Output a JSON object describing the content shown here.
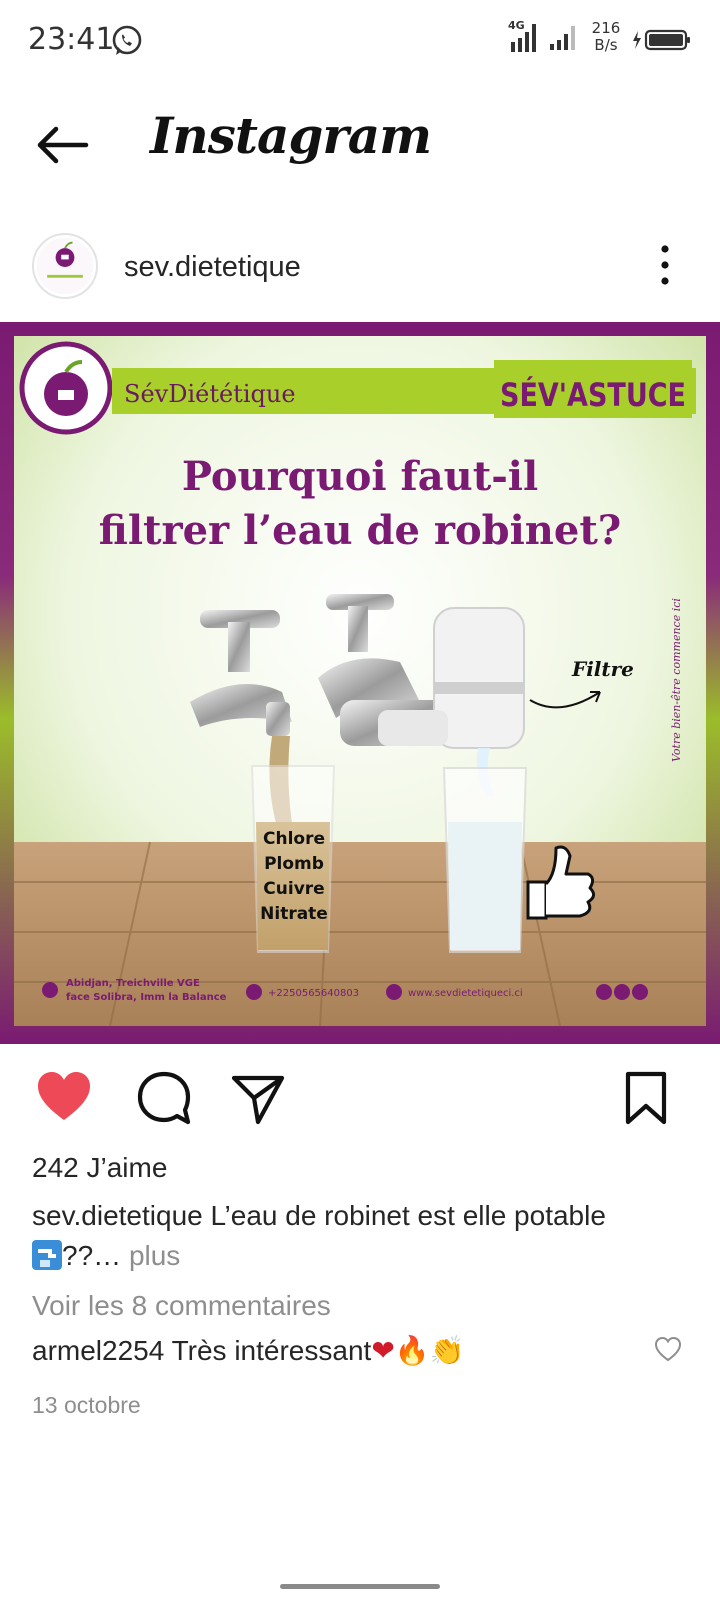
{
  "status_bar": {
    "time": "23:41",
    "network_type": "4G",
    "speed_value": "216",
    "speed_unit": "B/s"
  },
  "header": {
    "title": "Instagram"
  },
  "post": {
    "username": "sev.dietetique",
    "image": {
      "brand": "SévDiététique",
      "banner": "SÉV'ASTUCE",
      "headline_line1": "Pourquoi faut-il",
      "headline_line2": "filtrer l’eau de robinet?",
      "contaminants": [
        "Chlore",
        "Plomb",
        "Cuivre",
        "Nitrate"
      ],
      "filter_label": "Filtre",
      "side_text": "Votre bien-être commence ici",
      "address_line1": "Abidjan, Treichville VGE",
      "address_line2": "face Solibra, Imm la Balance",
      "phone": "+2250565640803",
      "website": "www.sevdietetiqueci.ci"
    },
    "likes": "242 J’aime",
    "caption_user": "sev.dietetique",
    "caption_text": "L’eau de robinet est elle potable",
    "caption_line2": "??…",
    "caption_more": "plus",
    "view_comments": "Voir les 8 commentaires",
    "comment_user": "armel2254",
    "comment_text": "Très intéressant",
    "date": "13 octobre"
  },
  "colors": {
    "like_red": "#ed4956",
    "brand_purple": "#7a1a72",
    "brand_green": "#a8cf2a"
  },
  "icons": {
    "back": "arrow-left-icon",
    "more": "more-vertical-icon",
    "like": "heart-filled-icon",
    "comment": "comment-bubble-icon",
    "share": "paper-plane-icon",
    "save": "bookmark-icon"
  }
}
